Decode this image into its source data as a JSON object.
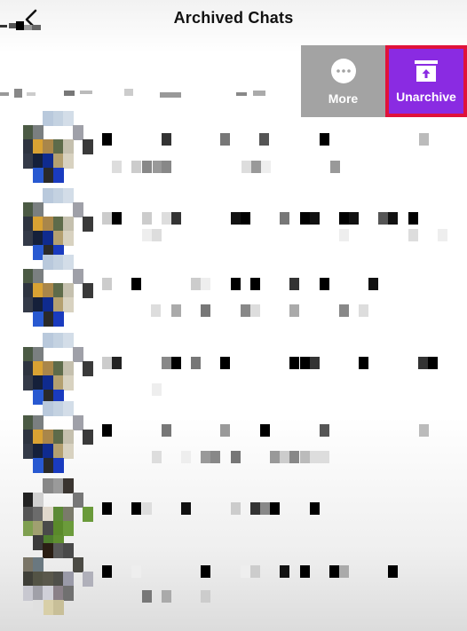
{
  "header": {
    "title": "Archived Chats",
    "back_icon": "chevron-left-icon"
  },
  "swipe_actions": {
    "more": {
      "label": "More",
      "icon": "ellipsis-circle-icon",
      "color": "#a3a3a3"
    },
    "unarchive": {
      "label": "Unarchive",
      "icon": "unarchive-box-icon",
      "color": "#8a2be2",
      "highlight_border": "#e0123a"
    }
  },
  "chats": [
    {
      "name": "[redacted]",
      "preview": "[redacted]"
    },
    {
      "name": "[redacted]",
      "preview": "[redacted]"
    },
    {
      "name": "[redacted]",
      "preview": "[redacted]"
    },
    {
      "name": "[redacted]",
      "preview": "[redacted]"
    },
    {
      "name": "[redacted]",
      "preview": "[redacted]"
    },
    {
      "name": "[redacted]",
      "preview": "[redacted]"
    },
    {
      "name": "[redacted]",
      "preview": "[redacted]"
    },
    {
      "name": "[redacted]",
      "preview": "[redacted]"
    }
  ]
}
